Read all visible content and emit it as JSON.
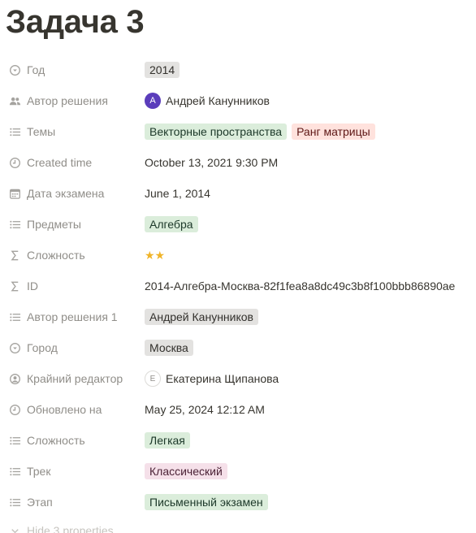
{
  "page": {
    "title": "Задача 3"
  },
  "properties": [
    {
      "icon": "select-icon",
      "label": "Год",
      "type": "tags",
      "tags": [
        {
          "text": "2014",
          "color": "gray"
        }
      ]
    },
    {
      "icon": "people-icon",
      "label": "Автор решения",
      "type": "person",
      "person": {
        "initial": "A",
        "name": "Андрей Канунников",
        "style": "filled"
      }
    },
    {
      "icon": "list-icon",
      "label": "Темы",
      "type": "tags",
      "tags": [
        {
          "text": "Векторные пространства",
          "color": "green"
        },
        {
          "text": "Ранг матрицы",
          "color": "red"
        }
      ]
    },
    {
      "icon": "clock-icon",
      "label": "Created time",
      "type": "text",
      "text": "October 13, 2021 9:30 PM"
    },
    {
      "icon": "calendar-icon",
      "label": "Дата экзамена",
      "type": "text",
      "text": "June 1, 2014"
    },
    {
      "icon": "list-icon",
      "label": "Предметы",
      "type": "tags",
      "tags": [
        {
          "text": "Алгебра",
          "color": "green"
        }
      ]
    },
    {
      "icon": "sigma-icon",
      "label": "Сложность",
      "type": "stars",
      "text": "★★",
      "rating": 2
    },
    {
      "icon": "sigma-icon",
      "label": "ID",
      "type": "text",
      "text": "2014-Алгебра-Москва-82f1fea8a8dc49c3b8f100bbb86890ae"
    },
    {
      "icon": "list-icon",
      "label": "Автор решения 1",
      "type": "tags",
      "tags": [
        {
          "text": "Андрей Канунников",
          "color": "gray"
        }
      ]
    },
    {
      "icon": "select-icon",
      "label": "Город",
      "type": "tags",
      "tags": [
        {
          "text": "Москва",
          "color": "gray"
        }
      ]
    },
    {
      "icon": "person-circle-icon",
      "label": "Крайний редактор",
      "type": "person",
      "person": {
        "initial": "E",
        "name": "Екатерина Щипанова",
        "style": "outline"
      }
    },
    {
      "icon": "clock-icon",
      "label": "Обновлено на",
      "type": "text",
      "text": "May 25, 2024 12:12 AM"
    },
    {
      "icon": "list-icon",
      "label": "Сложность",
      "type": "tags",
      "tags": [
        {
          "text": "Легкая",
          "color": "green"
        }
      ]
    },
    {
      "icon": "list-icon",
      "label": "Трек",
      "type": "tags",
      "tags": [
        {
          "text": "Классический",
          "color": "pink"
        }
      ]
    },
    {
      "icon": "list-icon",
      "label": "Этап",
      "type": "tags",
      "tags": [
        {
          "text": "Письменный экзамен",
          "color": "green"
        }
      ]
    }
  ],
  "hide_properties": {
    "label": "Hide 3 properties"
  },
  "colors": {
    "label": "#908e89",
    "text": "#37352f",
    "star": "#f0b429",
    "avatar": "#5b3dbb"
  }
}
